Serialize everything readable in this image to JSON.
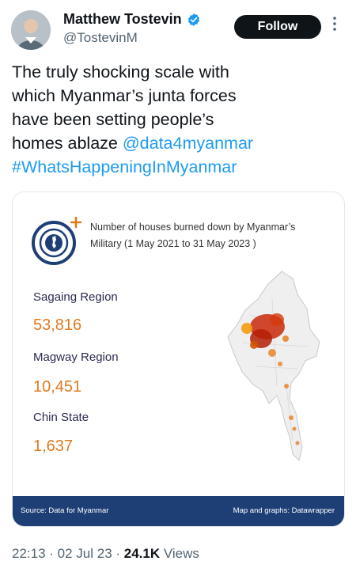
{
  "author": {
    "name": "Matthew Tostevin",
    "handle": "@TostevinM",
    "verified_color": "#1d9bf0"
  },
  "actions": {
    "follow_label": "Follow",
    "more_icon": "more-vertical-icon"
  },
  "tweet": {
    "lines": [
      "The truly shocking scale with",
      "which Myanmar’s junta forces",
      "have been setting people’s",
      "homes ablaze "
    ],
    "mention": "@data4myanmar",
    "hashtag": "#WhatsHappeningInMyanmar"
  },
  "card": {
    "title_line1": "Number of houses burned down by Myanmar’s",
    "title_line2": "Military (1 May 2021 to 31 May 2023 )",
    "logo_icon": "data4myanmar-logo",
    "stats": [
      {
        "label": "Sagaing Region",
        "value": "53,816"
      },
      {
        "label": "Magway Region",
        "value": "10,451"
      },
      {
        "label": "Chin State",
        "value": "1,637"
      }
    ],
    "map_icon": "myanmar-map",
    "footer_source": "Source: Data for Myanmar",
    "footer_credit": "Map and graphs: Datawrapper",
    "colors": {
      "accent": "#e07a1f",
      "footer_bg": "#1e3f76",
      "label": "#2b2b52"
    }
  },
  "meta": {
    "time": "22:13 · 02 Jul 23 · ",
    "views_count": "24.1K",
    "views_label": " Views"
  }
}
